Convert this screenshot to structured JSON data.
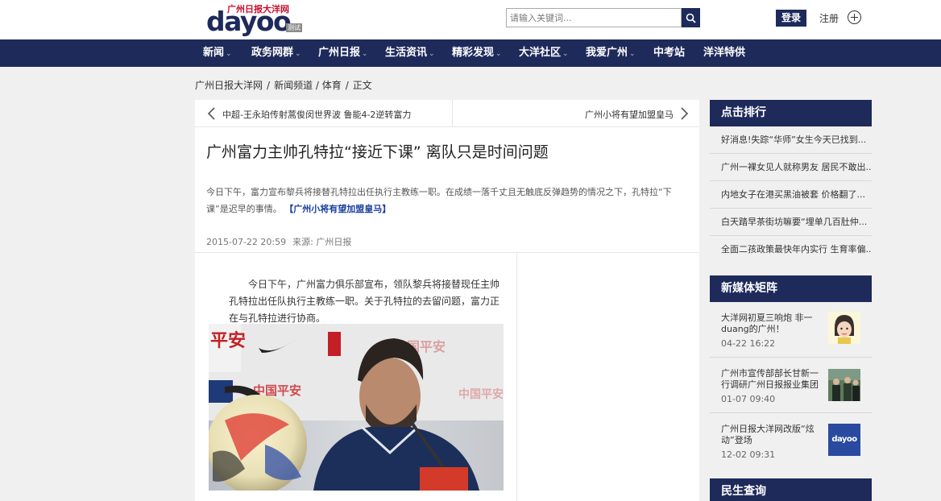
{
  "header": {
    "logo_top": "广州日报大洋网",
    "logo_main": "dayoo",
    "logo_badge": "测试",
    "search_placeholder": "请输入关键词...",
    "login_label": "登录",
    "register_label": "注册"
  },
  "nav": {
    "items": [
      {
        "label": "新闻",
        "caret": true
      },
      {
        "label": "政务网群",
        "caret": true
      },
      {
        "label": "广州日报",
        "caret": true
      },
      {
        "label": "生活资讯",
        "caret": true
      },
      {
        "label": "精彩发现",
        "caret": true
      },
      {
        "label": "大洋社区",
        "caret": true
      },
      {
        "label": "我爱广州",
        "caret": true
      },
      {
        "label": "中考站",
        "caret": false
      },
      {
        "label": "洋洋特供",
        "caret": false
      }
    ]
  },
  "breadcrumb": {
    "items": [
      "广州日报大洋网",
      "新闻频道 / 体育",
      "正文"
    ]
  },
  "article": {
    "prev_title": "中超-王永珀传射蒿俊闵世界波 鲁能4-2逆转富力",
    "next_title": "广州小将有望加盟皇马",
    "title": "广州富力主帅孔特拉“接近下课” 离队只是时间问题",
    "lead": "今日下午，富力宣布黎兵将接替孔特拉出任执行主教练一职。在成绩一落千丈且无触底反弹趋势的情况之下，孔特拉“下课”是迟早的事情。",
    "related_link": "【广州小将有望加盟皇马】",
    "date": "2015-07-22 20:59",
    "source": "来源: 广州日报",
    "body": "今日下午，广州富力俱乐部宣布，领队黎兵将接替现任主帅孔特拉出任队执行主教练一职。关于孔特拉的去留问题，富力正在与孔特拉进行协商。",
    "photo_sponsor_text": "中国平安",
    "photo_alt_text": "平安"
  },
  "sidebar": {
    "ranking_title": "点击排行",
    "ranking_items": [
      "好消息!失踪“华师”女生今天已找到...",
      "广州一裸女见人就称男友 居民不敢出...",
      "内地女子在港买黑油被套 价格翻了...",
      "白天踏早茶街坊嘛要“埋单几百肚仲...",
      "全面二孩政策最快年内实行 生育率偏..."
    ],
    "media_title": "新媒体矩阵",
    "media_items": [
      {
        "title": "大洋网初夏三响炮 非一duang的广州！",
        "time": "04-22 16:22",
        "thumb": "cartoon"
      },
      {
        "title": "广州市宣传部部长甘新一行调研广州日报报业集团",
        "time": "01-07 09:40",
        "thumb": "photo"
      },
      {
        "title": "广州日报大洋网改版“炫动”登场",
        "time": "12-02 09:31",
        "thumb": "dayoo"
      }
    ],
    "thumb_dayoo_text": "dayoo",
    "service_title": "民生查询"
  },
  "colors": {
    "brand_navy": "#1e2a5a",
    "link_blue": "#1a3fa0",
    "logo_red": "#c8102e",
    "page_bg": "#f0f0f0"
  }
}
